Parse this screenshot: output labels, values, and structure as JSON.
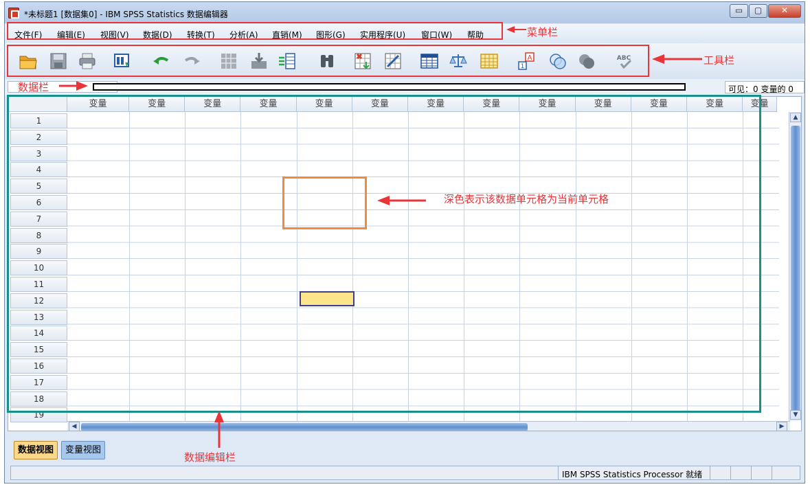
{
  "window": {
    "title": "*未标题1 [数据集0] - IBM SPSS Statistics 数据编辑器",
    "controls": {
      "minimize": "▭",
      "maximize": "▢",
      "close": "✕"
    }
  },
  "menu": [
    {
      "label": "文件(F)"
    },
    {
      "label": "编辑(E)"
    },
    {
      "label": "视图(V)"
    },
    {
      "label": "数据(D)"
    },
    {
      "label": "转换(T)"
    },
    {
      "label": "分析(A)"
    },
    {
      "label": "直销(M)"
    },
    {
      "label": "图形(G)"
    },
    {
      "label": "实用程序(U)"
    },
    {
      "label": "窗口(W)"
    },
    {
      "label": "帮助"
    }
  ],
  "toolbar": {
    "icons": [
      "open-folder-icon",
      "save-icon",
      "print-icon",
      "recall-dialog-icon",
      "undo-icon",
      "redo-icon",
      "goto-case-icon",
      "goto-variable-icon",
      "variables-icon",
      "find-icon",
      "insert-case-icon",
      "insert-variable-icon",
      "split-file-icon",
      "weight-cases-icon",
      "select-cases-icon",
      "value-labels-icon",
      "use-variable-sets-icon",
      "show-all-variables-icon",
      "spell-check-icon"
    ]
  },
  "databar": {
    "visible_vars": "可见：0 变量的 0"
  },
  "grid": {
    "column_header": "变量",
    "column_count": 13,
    "rows": [
      "1",
      "2",
      "3",
      "4",
      "5",
      "6",
      "7",
      "8",
      "9",
      "10",
      "11",
      "12",
      "13",
      "14",
      "15",
      "16",
      "17",
      "18",
      "19"
    ],
    "active_cell": {
      "row": 6,
      "column": 5
    }
  },
  "tabs": {
    "data_view": "数据视图",
    "variable_view": "变量视图"
  },
  "statusbar": {
    "text": "IBM SPSS Statistics Processor 就绪"
  },
  "annotations": {
    "menubar": "菜单栏",
    "toolbar": "工具栏",
    "databar": "数据栏",
    "editor": "数据编辑栏",
    "active_cell": "深色表示该数据单元格为当前单元格"
  },
  "colors": {
    "annotation_red": "#e8353a",
    "editor_frame": "#15918a",
    "active_cell_frame": "#f08a3c",
    "active_cell_fill": "#fde38a",
    "data_view_tab": "#fbd88a",
    "variable_view_tab": "#a7c8ec"
  }
}
